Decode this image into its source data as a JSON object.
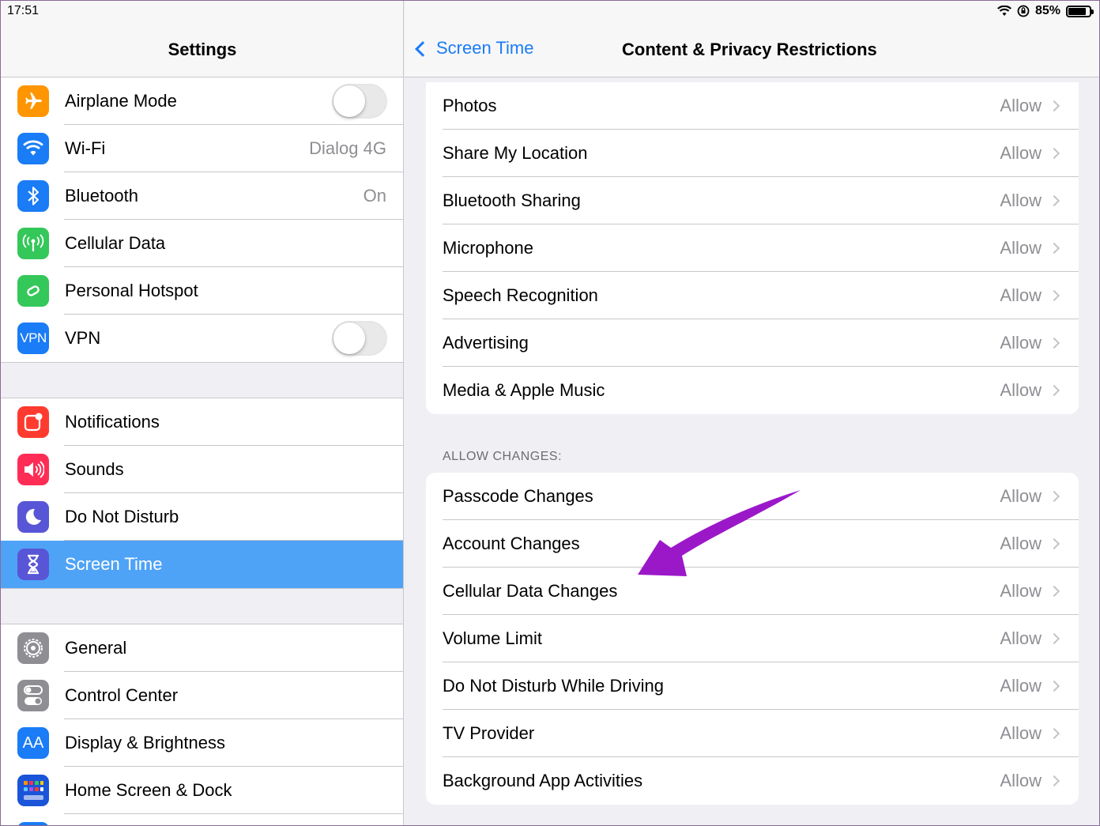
{
  "status": {
    "time": "17:51",
    "battery": "85%",
    "battery_level": 0.85
  },
  "left": {
    "title": "Settings",
    "groups": [
      [
        {
          "label": "Airplane Mode",
          "icon": "airplane-icon",
          "color": "#ff9500",
          "control": "toggle",
          "on": false
        },
        {
          "label": "Wi-Fi",
          "icon": "wifi-icon",
          "color": "#1a7cf6",
          "value": "Dialog 4G"
        },
        {
          "label": "Bluetooth",
          "icon": "bluetooth-icon",
          "color": "#1a7cf6",
          "value": "On"
        },
        {
          "label": "Cellular Data",
          "icon": "antenna-icon",
          "color": "#34c759"
        },
        {
          "label": "Personal Hotspot",
          "icon": "hotspot-icon",
          "color": "#34c759"
        },
        {
          "label": "VPN",
          "icon": "vpn-icon",
          "icon_text": "VPN",
          "color": "#1a7cf6",
          "control": "toggle",
          "on": false
        }
      ],
      [
        {
          "label": "Notifications",
          "icon": "notifications-icon",
          "color": "#ff3b30"
        },
        {
          "label": "Sounds",
          "icon": "speaker-icon",
          "color": "#ff2d55"
        },
        {
          "label": "Do Not Disturb",
          "icon": "moon-icon",
          "color": "#5856d6"
        },
        {
          "label": "Screen Time",
          "icon": "hourglass-icon",
          "color": "#5856d6",
          "selected": true
        }
      ],
      [
        {
          "label": "General",
          "icon": "gear-icon",
          "color": "#8e8e93"
        },
        {
          "label": "Control Center",
          "icon": "switches-icon",
          "color": "#8e8e93"
        },
        {
          "label": "Display & Brightness",
          "icon": "text-size-icon",
          "icon_text": "AA",
          "color": "#1a7cf6"
        },
        {
          "label": "Home Screen & Dock",
          "icon": "app-grid-icon",
          "color": "#1a54d9"
        },
        {
          "label": "",
          "icon": "partial-icon",
          "color": "#1a7cf6"
        }
      ]
    ]
  },
  "right": {
    "back_label": "Screen Time",
    "title": "Content & Privacy Restrictions",
    "privacy_rows": [
      {
        "label": "Photos",
        "value": "Allow"
      },
      {
        "label": "Share My Location",
        "value": "Allow"
      },
      {
        "label": "Bluetooth Sharing",
        "value": "Allow"
      },
      {
        "label": "Microphone",
        "value": "Allow"
      },
      {
        "label": "Speech Recognition",
        "value": "Allow"
      },
      {
        "label": "Advertising",
        "value": "Allow"
      },
      {
        "label": "Media & Apple Music",
        "value": "Allow"
      }
    ],
    "allow_changes_header": "ALLOW CHANGES:",
    "changes_rows": [
      {
        "label": "Passcode Changes",
        "value": "Allow"
      },
      {
        "label": "Account Changes",
        "value": "Allow"
      },
      {
        "label": "Cellular Data Changes",
        "value": "Allow"
      },
      {
        "label": "Volume Limit",
        "value": "Allow"
      },
      {
        "label": "Do Not Disturb While Driving",
        "value": "Allow"
      },
      {
        "label": "TV Provider",
        "value": "Allow"
      },
      {
        "label": "Background App Activities",
        "value": "Allow"
      }
    ]
  },
  "annotation": {
    "color": "#9b18c9"
  }
}
